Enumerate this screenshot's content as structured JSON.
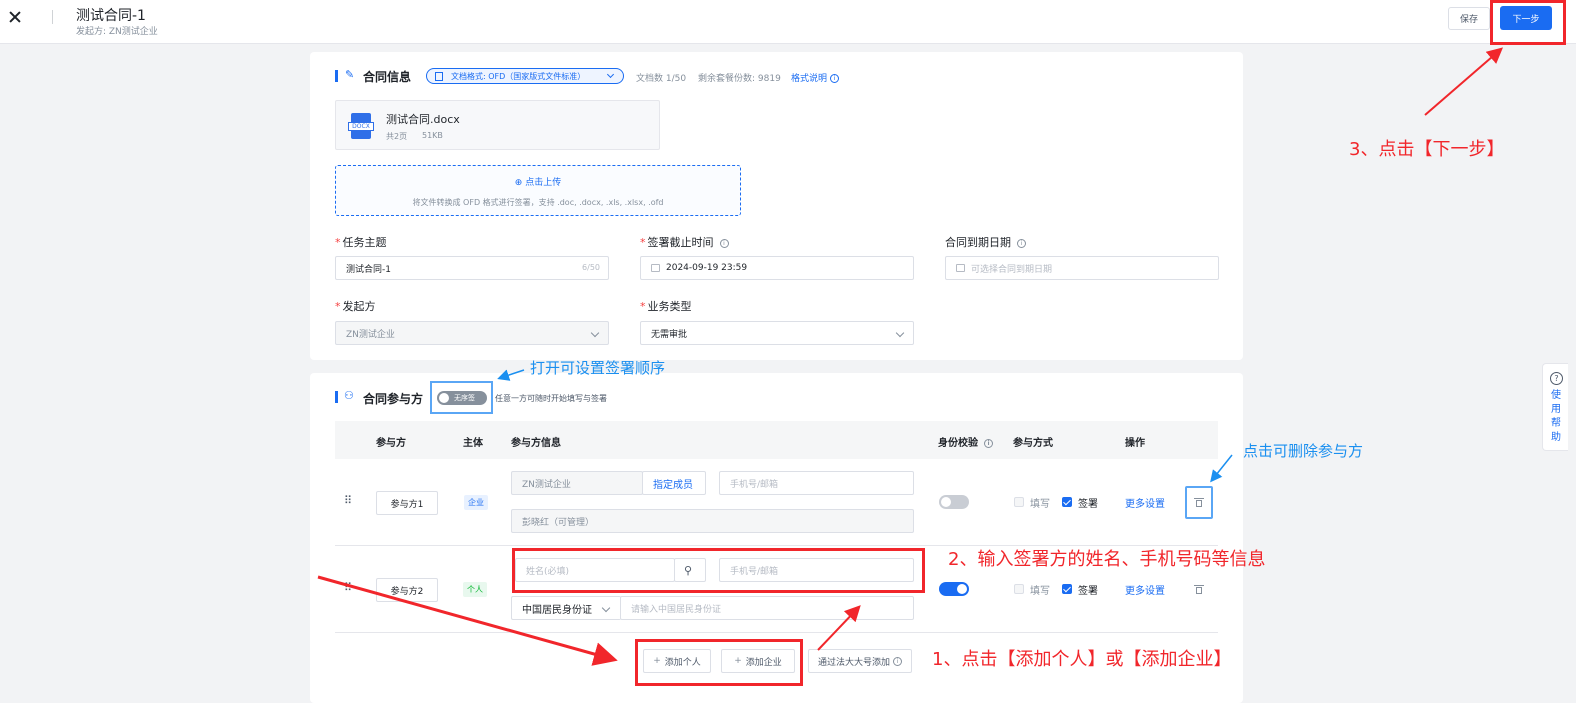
{
  "header": {
    "title": "测试合同-1",
    "subtitle": "发起方: ZN测试企业",
    "save_label": "保存",
    "next_label": "下一步"
  },
  "contract_info": {
    "section_title": "合同信息",
    "format_pill": "文档格式: OFD（国家版式文件标准）",
    "doc_count": "文档数 1/50",
    "remaining": "剩余套餐份数: 9819",
    "format_help": "格式说明",
    "file": {
      "badge": "DOCX",
      "name": "测试合同.docx",
      "pages": "共2页",
      "size": "51KB"
    },
    "upload": {
      "label": "点击上传",
      "hint": "将文件转换成 OFD 格式进行签署，支持 .doc, .docx, .xls, .xlsx, .ofd"
    },
    "fields": {
      "subject_label": "任务主题",
      "subject_value": "测试合同-1",
      "subject_count": "6/50",
      "deadline_label": "签署截止时间",
      "deadline_value": "2024-09-19 23:59",
      "expire_label": "合同到期日期",
      "expire_placeholder": "可选择合同到期日期",
      "initiator_label": "发起方",
      "initiator_value": "ZN测试企业",
      "biz_type_label": "业务类型",
      "biz_type_value": "无需审批"
    }
  },
  "participants": {
    "section_title": "合同参与方",
    "order_toggle_label": "无序签",
    "order_hint": "任意一方可随时开始填写与签署",
    "columns": [
      "参与方",
      "主体",
      "参与方信息",
      "身份校验",
      "参与方式",
      "操作"
    ],
    "rows": [
      {
        "name": "参与方1",
        "type_tag": "企业",
        "company": "ZN测试企业",
        "assign_member": "指定成员",
        "phone_placeholder": "手机号/邮箱",
        "member": "彭晓红（可管理）",
        "verify_on": false,
        "fill_label": "填写",
        "sign_label": "签署",
        "more_label": "更多设置"
      },
      {
        "name": "参与方2",
        "type_tag": "个人",
        "name_placeholder": "姓名(必填)",
        "phone_placeholder": "手机号/邮箱",
        "id_type": "中国居民身份证",
        "id_placeholder": "请输入中国居民身份证",
        "verify_on": true,
        "fill_label": "填写",
        "sign_label": "签署",
        "more_label": "更多设置"
      }
    ],
    "add_person": "添加个人",
    "add_company": "添加企业",
    "add_legal": "通过法大大号添加"
  },
  "help_widget": {
    "label": "使用帮助"
  },
  "annotations": {
    "step1": "1、点击【添加个人】或【添加企业】",
    "step2": "2、输入签署方的姓名、手机号码等信息",
    "step3": "3、点击【下一步】",
    "order_tip": "打开可设置签署顺序",
    "delete_tip": "点击可删除参与方"
  },
  "colors": {
    "primary": "#1a6cf2",
    "annotation_red": "#f1262b",
    "annotation_blue": "#1a8ff0"
  }
}
